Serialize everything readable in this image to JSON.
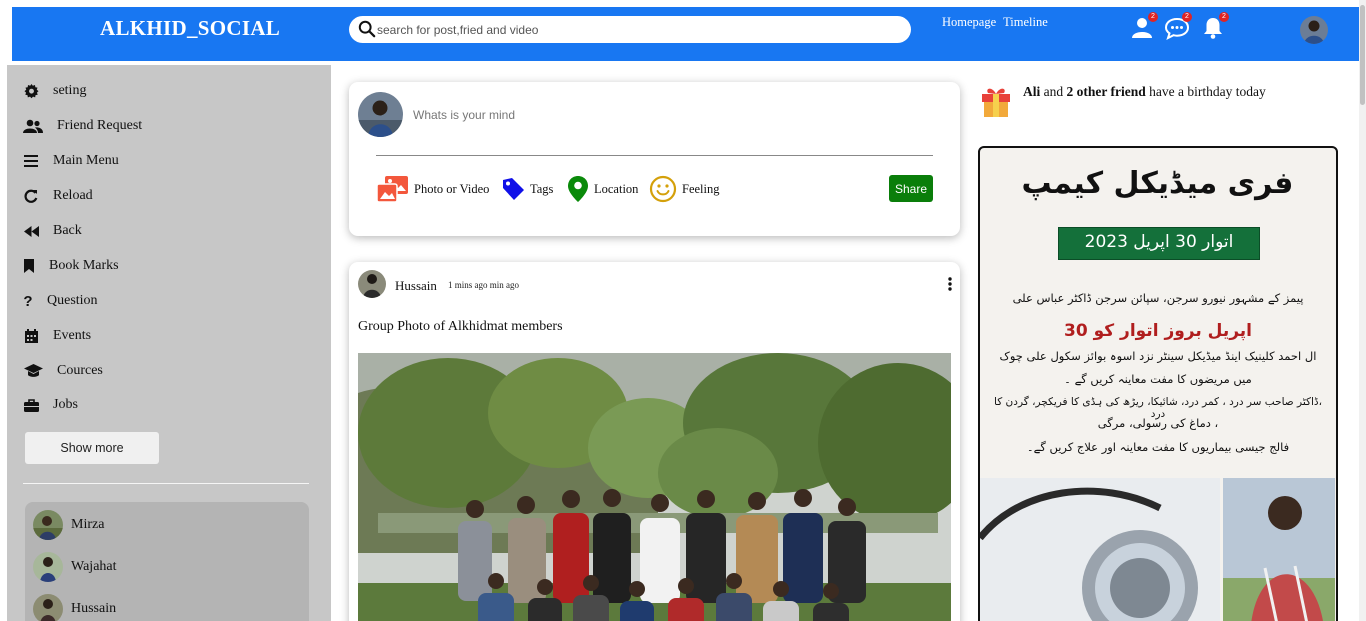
{
  "header": {
    "brand": "ALKHID_SOCIAL",
    "search_placeholder": "search for post,fried and video",
    "links": [
      "Homepage",
      "Timeline"
    ],
    "badges": {
      "friends": "2",
      "messages": "2",
      "notifications": "2"
    },
    "accent_color": "#1877f2"
  },
  "sidebar": {
    "items": [
      {
        "label": "seting",
        "icon": "gear-icon"
      },
      {
        "label": "Friend Request",
        "icon": "users-icon"
      },
      {
        "label": "Main Menu",
        "icon": "hamburger-icon"
      },
      {
        "label": "Reload",
        "icon": "reload-icon"
      },
      {
        "label": "Back",
        "icon": "backward-icon"
      },
      {
        "label": "Book Marks",
        "icon": "bookmark-icon"
      },
      {
        "label": "Question",
        "icon": "question-icon"
      },
      {
        "label": "Events",
        "icon": "calendar-icon"
      },
      {
        "label": "Cources",
        "icon": "graduation-cap-icon"
      },
      {
        "label": "Jobs",
        "icon": "briefcase-icon"
      }
    ],
    "show_more": "Show more",
    "friends": [
      "Mirza",
      "Wajahat",
      "Hussain"
    ]
  },
  "composer": {
    "placeholder": "Whats is your mind",
    "actions": [
      {
        "label": "Photo or Video",
        "icon": "photo-icon",
        "color": "#f3573c"
      },
      {
        "label": "Tags",
        "icon": "tag-icon",
        "color": "#1010e8"
      },
      {
        "label": "Location",
        "icon": "location-pin-icon",
        "color": "#0a8a0a"
      },
      {
        "label": "Feeling",
        "icon": "smiley-icon",
        "color": "#d4a00a"
      }
    ],
    "share": "Share"
  },
  "post": {
    "author": "Hussain",
    "time": "1 mins ago min ago",
    "text": "Group Photo of Alkhidmat members"
  },
  "birthday": {
    "name": "Ali",
    "and": "and",
    "others": "2 other friend",
    "rest": "have a birthday today"
  },
  "ad": {
    "title": "فری میڈیکل کیمپ",
    "date": "اتوار 30 اپریل 2023",
    "line1": "پیمز کے مشہور نیورو سرجن، سپائن سرجن ڈاکٹر عباس علی",
    "line2": "اپریل بروز اتوار کو 30",
    "line3": "ال احمد کلینیک اینڈ میڈیکل سینٹر نزد اسوہ بوائز سکول علی چوک",
    "line4": "میں مریضوں کا مفت معاینہ کریں گے ۔",
    "line5": "،ڈاکٹر صاحب سر درد ، کمر درد، شائیکا، ریڑھ کی ہڈی کا فریکچر، گردن کا درد",
    "line6": "، دماغ کی رسولی، مرگی",
    "line7": "فالج جیسی بیماریوں کا مفت معاینہ اور علاج کریں گے۔"
  }
}
